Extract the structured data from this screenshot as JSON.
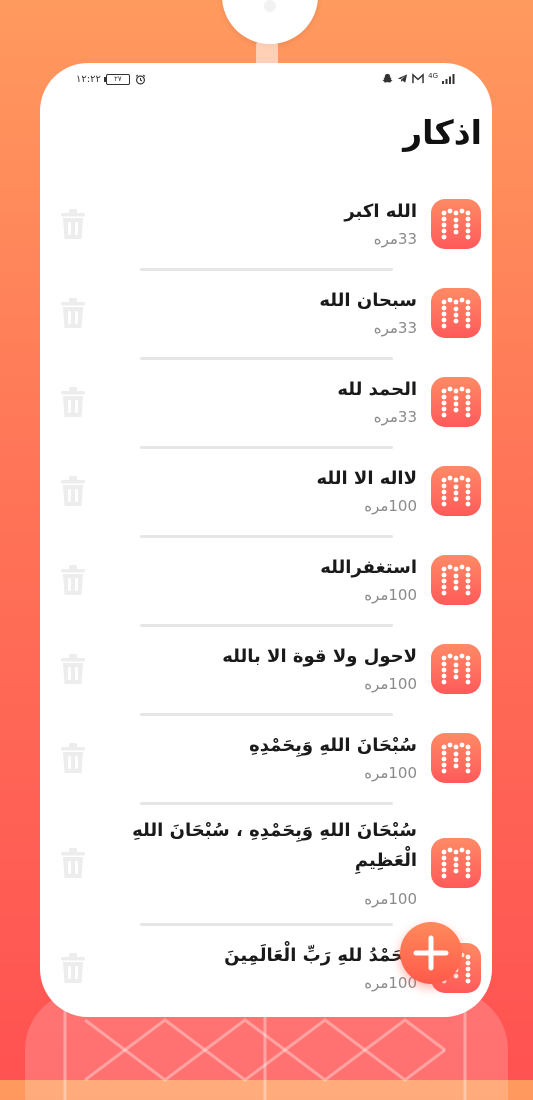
{
  "status": {
    "time": "۱۲:۲۲",
    "battery": "۲۷",
    "network": "4G"
  },
  "title": "اذكار",
  "items": [
    {
      "name": "الله اكبر",
      "count": "33مره"
    },
    {
      "name": "سبحان الله",
      "count": "33مره"
    },
    {
      "name": "الحمد لله",
      "count": "33مره"
    },
    {
      "name": "لااله الا الله",
      "count": "100مره"
    },
    {
      "name": "استغفرالله",
      "count": "100مره"
    },
    {
      "name": "لاحول ولا قوة الا بالله",
      "count": "100مره"
    },
    {
      "name": "سُبْحَانَ اللهِ وَبِحَمْدِهِ",
      "count": "100مره"
    },
    {
      "name": "سُبْحَانَ اللهِ وَبِحَمْدِهِ ، سُبْحَانَ اللهِ الْعَظِيمِ",
      "count": "100مره"
    },
    {
      "name": "الْحَمْدُ للهِ رَبِّ الْعَالَمِينَ",
      "count": "100مره"
    }
  ],
  "icons": {
    "item_icon": "tasbih-beads-icon",
    "delete_icon": "trash-icon",
    "add_icon": "plus-icon"
  },
  "colors": {
    "accent": "#ff6f5c",
    "gradient_top": "#ff9a5e",
    "gradient_bottom": "#ff5252"
  }
}
